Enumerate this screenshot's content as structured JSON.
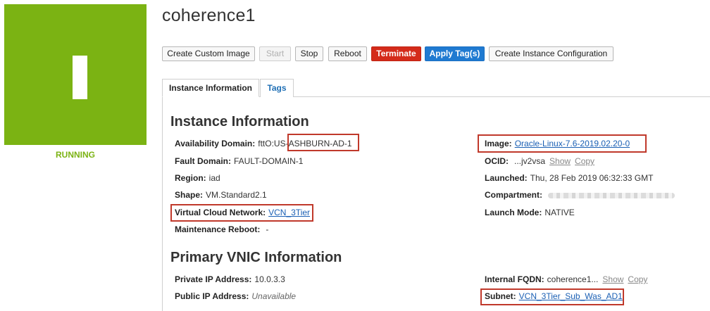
{
  "instance": {
    "name": "coherence1",
    "status": "RUNNING",
    "status_color": "#7bb313",
    "icon": "instance-glyph-icon"
  },
  "actions": {
    "create_custom_image": "Create Custom Image",
    "start": "Start",
    "stop": "Stop",
    "reboot": "Reboot",
    "terminate": "Terminate",
    "apply_tags": "Apply Tag(s)",
    "create_instance_config": "Create Instance Configuration"
  },
  "tabs": {
    "instance_info": "Instance Information",
    "tags": "Tags"
  },
  "instance_info": {
    "heading": "Instance Information",
    "availability_domain": {
      "label": "Availability Domain:",
      "value_prefix": "fttO:US-",
      "value_highlight": "ASHBURN-AD-1"
    },
    "fault_domain": {
      "label": "Fault Domain:",
      "value": "FAULT-DOMAIN-1"
    },
    "region": {
      "label": "Region:",
      "value": "iad"
    },
    "shape": {
      "label": "Shape:",
      "value": "VM.Standard2.1"
    },
    "vcn": {
      "label": "Virtual Cloud Network:",
      "value": "VCN_3Tier"
    },
    "maintenance_reboot": {
      "label": "Maintenance Reboot:",
      "value": "-"
    },
    "image": {
      "label": "Image:",
      "value": "Oracle-Linux-7.6-2019.02.20-0"
    },
    "ocid": {
      "label": "OCID:",
      "value": "...jv2vsa",
      "show": "Show",
      "copy": "Copy"
    },
    "launched": {
      "label": "Launched:",
      "value": "Thu, 28 Feb 2019 06:32:33 GMT"
    },
    "compartment": {
      "label": "Compartment:",
      "value": ""
    },
    "launch_mode": {
      "label": "Launch Mode:",
      "value": "NATIVE"
    }
  },
  "vnic_info": {
    "heading": "Primary VNIC Information",
    "private_ip": {
      "label": "Private IP Address:",
      "value": "10.0.3.3"
    },
    "public_ip": {
      "label": "Public IP Address:",
      "value": "Unavailable"
    },
    "internal_fqdn": {
      "label": "Internal FQDN:",
      "value": "coherence1...",
      "show": "Show",
      "copy": "Copy"
    },
    "subnet": {
      "label": "Subnet:",
      "value": "VCN_3Tier_Sub_Was_AD1"
    }
  },
  "colors": {
    "highlight_border": "#c0392b",
    "terminate": "#d42b1a",
    "primary": "#1f7ad1",
    "link": "#1a5fb4"
  }
}
